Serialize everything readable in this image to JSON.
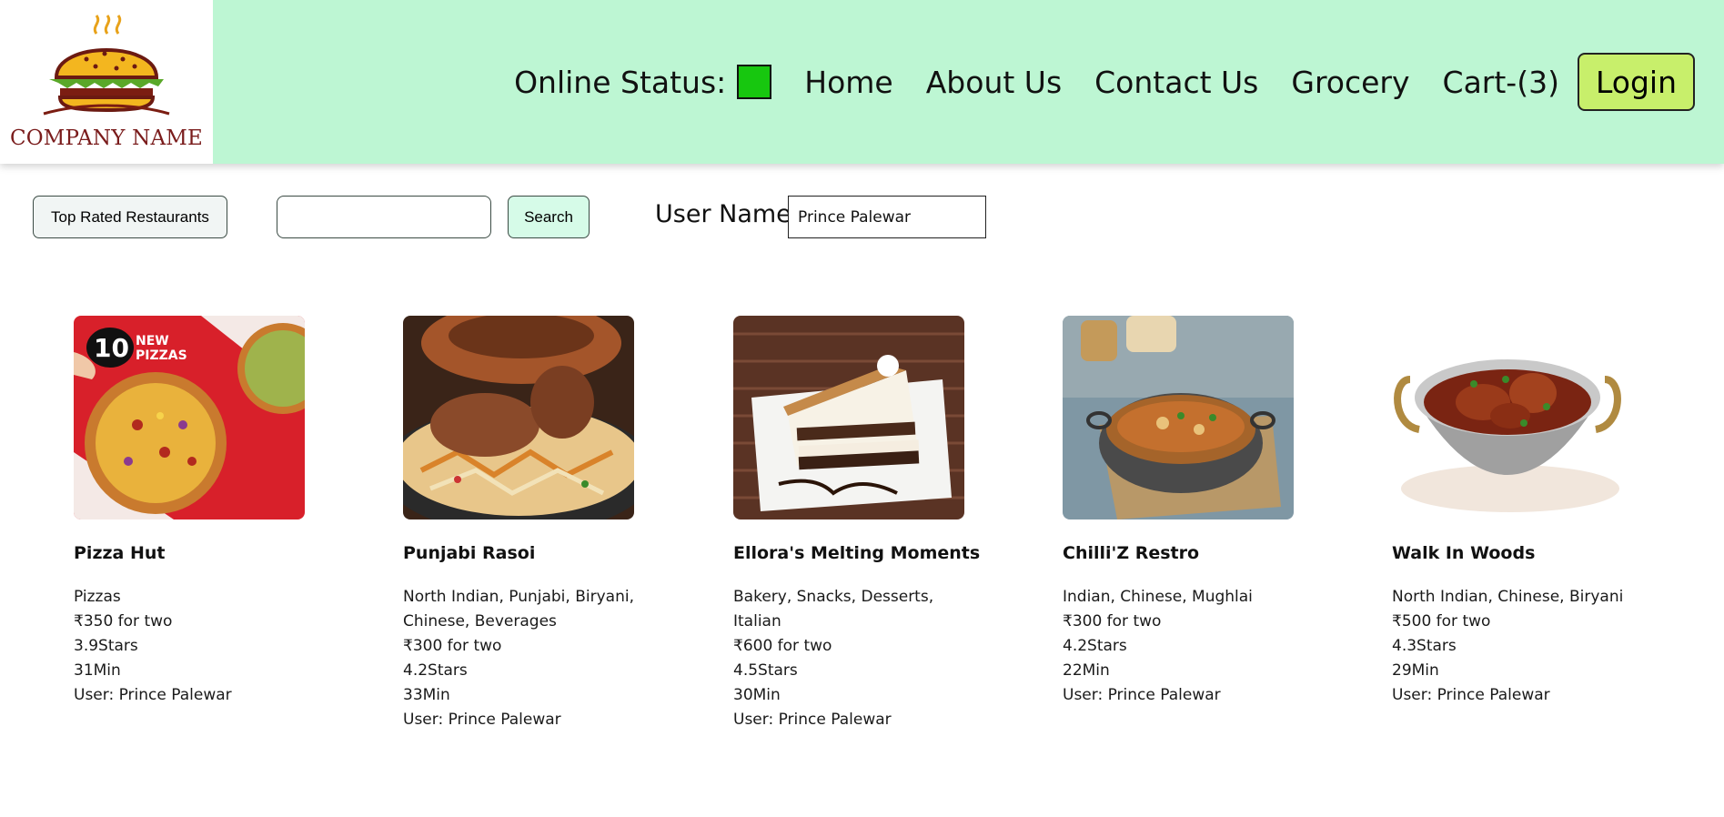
{
  "brand": {
    "logo_text": "COMPANY NAME"
  },
  "nav": {
    "online_status_label": "Online Status:",
    "online_status_color": "#17c70f",
    "items": [
      "Home",
      "About Us",
      "Contact Us",
      "Grocery",
      "Cart-(3)"
    ],
    "login_label": "Login"
  },
  "toolbar": {
    "top_rated_label": "Top Rated Restaurants",
    "search_value": "",
    "search_label": "Search",
    "user_name_label": "User Name:",
    "user_name_value": "Prince Palewar"
  },
  "restaurants": [
    {
      "name": "Pizza Hut",
      "cuisines": "Pizzas",
      "cost": "₹350 for two",
      "rating": "3.9Stars",
      "time": "31Min",
      "user": "User: Prince Palewar",
      "image": "pizza-image"
    },
    {
      "name": "Punjabi Rasoi",
      "cuisines": "North Indian, Punjabi, Biryani, Chinese, Beverages",
      "cost": "₹300 for two",
      "rating": "4.2Stars",
      "time": "33Min",
      "user": "User: Prince Palewar",
      "image": "biryani-image"
    },
    {
      "name": "Ellora's Melting Moments",
      "cuisines": "Bakery, Snacks, Desserts, Italian",
      "cost": "₹600 for two",
      "rating": "4.5Stars",
      "time": "30Min",
      "user": "User: Prince Palewar",
      "image": "cake-image"
    },
    {
      "name": "Chilli'Z Restro",
      "cuisines": "Indian, Chinese, Mughlai",
      "cost": "₹300 for two",
      "rating": "4.2Stars",
      "time": "22Min",
      "user": "User: Prince Palewar",
      "image": "curry-bowl-image"
    },
    {
      "name": "Walk In Woods",
      "cuisines": "North Indian, Chinese, Biryani",
      "cost": "₹500 for two",
      "rating": "4.3Stars",
      "time": "29Min",
      "user": "User: Prince Palewar",
      "image": "curry-pot-image"
    }
  ]
}
